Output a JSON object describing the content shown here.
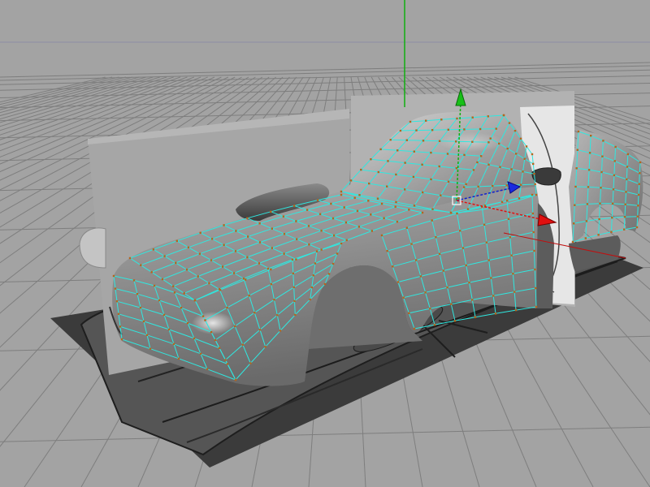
{
  "viewport": {
    "background_color": "#a3a3a3",
    "grid_color": "#7e7e7e",
    "horizon_line_color": "#8d8da6",
    "wire_color": "#2fe8e0",
    "vertex_color": "#b5651d",
    "axis_colors": {
      "x": "#e01010",
      "y": "#10b010",
      "z": "#1020d0"
    }
  },
  "scene": {
    "model": "car-body-wireframe",
    "reference_planes": [
      "side-blueprint",
      "front-blueprint",
      "top-blueprint"
    ],
    "manipulator": "move-tool-gizmo",
    "icons": [
      "world-y-axis",
      "move-gizmo-x-arrow",
      "move-gizmo-y-arrow",
      "move-gizmo-z-arrow"
    ]
  }
}
